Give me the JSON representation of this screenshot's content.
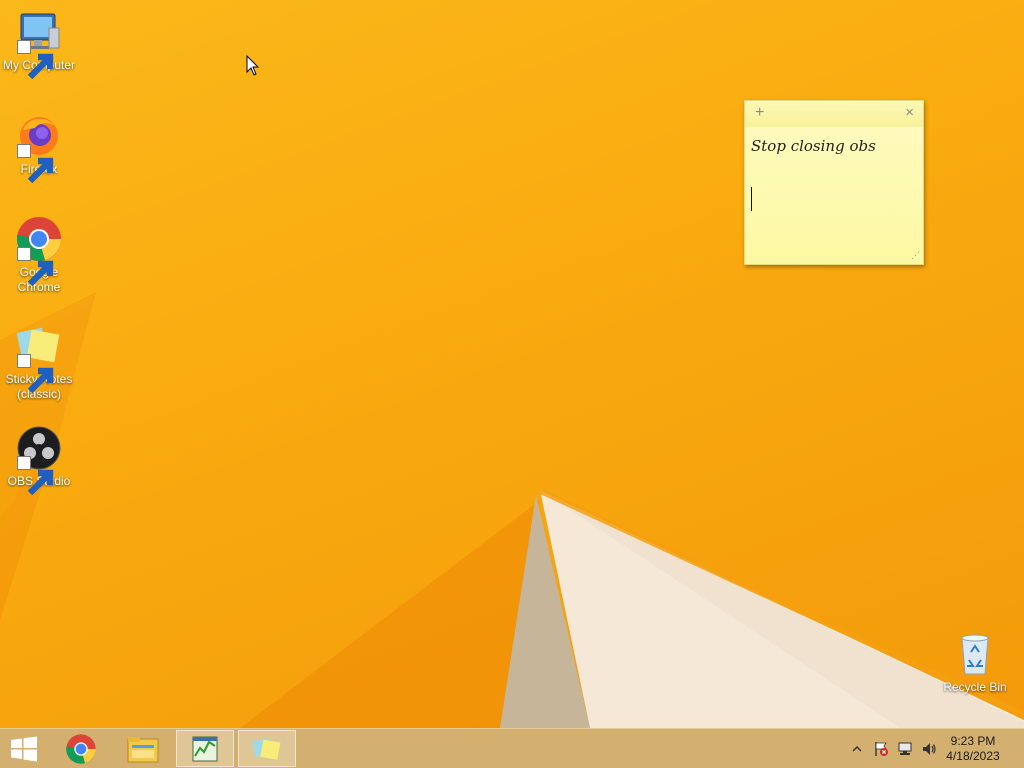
{
  "desktop": {
    "icons": [
      {
        "label": "My Computer",
        "icon": "computer-icon"
      },
      {
        "label": "Firefox",
        "icon": "firefox-icon"
      },
      {
        "label": "Google Chrome",
        "icon": "chrome-icon"
      },
      {
        "label": "Sticky Notes (classic)",
        "icon": "sticky-notes-icon"
      },
      {
        "label": "OBS Studio",
        "icon": "obs-icon"
      }
    ],
    "recycle_bin": {
      "label": "Recycle Bin",
      "icon": "recycle-bin-icon"
    }
  },
  "sticky_note": {
    "text": "Stop closing obs",
    "add_glyph": "+",
    "close_glyph": "×",
    "color": "#fdf9a8"
  },
  "taskbar": {
    "buttons": [
      {
        "icon": "windows-start-icon"
      },
      {
        "icon": "chrome-icon"
      },
      {
        "icon": "file-explorer-icon"
      },
      {
        "icon": "task-manager-icon"
      },
      {
        "icon": "sticky-notes-icon"
      }
    ],
    "tray": [
      "show-hidden-icons-chevron",
      "action-center-flag-icon",
      "network-icon",
      "volume-icon"
    ],
    "clock": {
      "time": "9:23 PM",
      "date": "4/18/2023"
    }
  },
  "colors": {
    "wallpaper": "#f9aa0f",
    "taskbar": "#d3b070"
  }
}
